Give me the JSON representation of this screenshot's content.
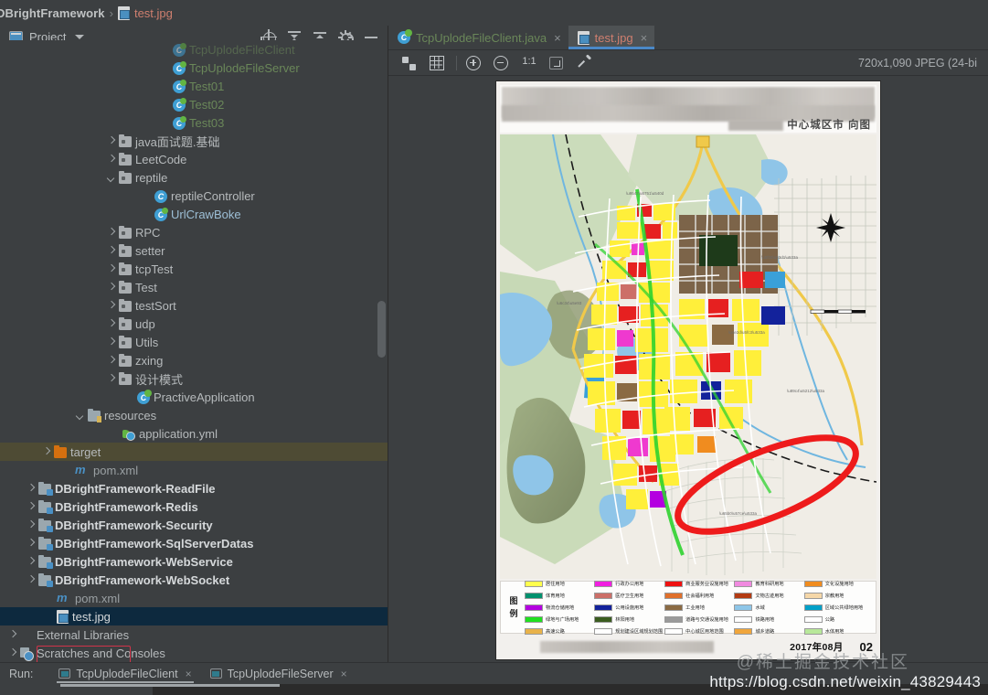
{
  "breadcrumb": {
    "root": "DBrightFramework",
    "separator": "›",
    "file": "test.jpg",
    "file_icon": "image-file-icon"
  },
  "project_panel": {
    "title": "Project",
    "dropdown_icon": "chevron-down-icon",
    "tools": [
      {
        "name": "locate-in-tree-icon",
        "label": "Select Opened File"
      },
      {
        "name": "expand-all-icon",
        "label": "Expand All"
      },
      {
        "name": "collapse-all-icon",
        "label": "Collapse All"
      },
      {
        "name": "settings-gear-icon",
        "label": "Settings"
      },
      {
        "name": "hide-panel-icon",
        "label": "Hide"
      }
    ]
  },
  "tree": {
    "rows": [
      {
        "label": "TcpUplodeFileClient",
        "indent": 175,
        "arrow": "none",
        "icon": "java-class-green-icon",
        "color": "#6a8759",
        "clipped": true
      },
      {
        "label": "TcpUplodeFileServer",
        "indent": 175,
        "arrow": "none",
        "icon": "java-class-green-icon",
        "color": "#6a8759"
      },
      {
        "label": "Test01",
        "indent": 175,
        "arrow": "none",
        "icon": "java-class-green-icon",
        "color": "#6a8759"
      },
      {
        "label": "Test02",
        "indent": 175,
        "arrow": "none",
        "icon": "java-class-green-icon",
        "color": "#6a8759"
      },
      {
        "label": "Test03",
        "indent": 175,
        "arrow": "none",
        "icon": "java-class-green-icon",
        "color": "#6a8759"
      },
      {
        "label": "java面试题.基础",
        "indent": 116,
        "arrow": "right",
        "icon": "package-folder-icon",
        "color": "#b6babc"
      },
      {
        "label": "LeetCode",
        "indent": 116,
        "arrow": "right",
        "icon": "package-folder-icon",
        "color": "#b6babc"
      },
      {
        "label": "reptile",
        "indent": 116,
        "arrow": "down",
        "icon": "package-folder-icon",
        "color": "#b6babc"
      },
      {
        "label": "reptileController",
        "indent": 155,
        "arrow": "none",
        "icon": "java-class-icon",
        "color": "#b6babc"
      },
      {
        "label": "UrlCrawBoke",
        "indent": 155,
        "arrow": "none",
        "icon": "java-class-green-icon",
        "color": "#9dbfd6"
      },
      {
        "label": "RPC",
        "indent": 116,
        "arrow": "right",
        "icon": "package-folder-icon",
        "color": "#b6babc"
      },
      {
        "label": "setter",
        "indent": 116,
        "arrow": "right",
        "icon": "package-folder-icon",
        "color": "#b6babc"
      },
      {
        "label": "tcpTest",
        "indent": 116,
        "arrow": "right",
        "icon": "package-folder-icon",
        "color": "#b6babc"
      },
      {
        "label": "Test",
        "indent": 116,
        "arrow": "right",
        "icon": "package-folder-icon",
        "color": "#b6babc"
      },
      {
        "label": "testSort",
        "indent": 116,
        "arrow": "right",
        "icon": "package-folder-icon",
        "color": "#b6babc"
      },
      {
        "label": "udp",
        "indent": 116,
        "arrow": "right",
        "icon": "package-folder-icon",
        "color": "#b6babc"
      },
      {
        "label": "Utils",
        "indent": 116,
        "arrow": "right",
        "icon": "package-folder-icon",
        "color": "#b6babc"
      },
      {
        "label": "zxing",
        "indent": 116,
        "arrow": "right",
        "icon": "package-folder-icon",
        "color": "#b6babc"
      },
      {
        "label": "设计模式",
        "indent": 116,
        "arrow": "right",
        "icon": "package-folder-icon",
        "color": "#b6babc"
      },
      {
        "label": "PractiveApplication",
        "indent": 136,
        "arrow": "none",
        "icon": "spring-boot-class-icon",
        "color": "#b6babc"
      },
      {
        "label": "resources",
        "indent": 82,
        "arrow": "down",
        "icon": "resources-folder-icon",
        "color": "#b6babc"
      },
      {
        "label": "application.yml",
        "indent": 120,
        "arrow": "none",
        "icon": "yaml-file-icon",
        "color": "#b6babc"
      },
      {
        "label": "target",
        "indent": 45,
        "arrow": "right",
        "icon": "excluded-folder-icon",
        "color": "#b6babc",
        "highlight": "target"
      },
      {
        "label": "pom.xml",
        "indent": 68,
        "arrow": "none",
        "icon": "maven-file-icon",
        "color": "#9aa0a3"
      },
      {
        "label": "DBrightFramework-ReadFile",
        "indent": 28,
        "arrow": "right",
        "icon": "module-folder-icon",
        "color": "#d6d9db",
        "bold": true
      },
      {
        "label": "DBrightFramework-Redis",
        "indent": 28,
        "arrow": "right",
        "icon": "module-folder-icon",
        "color": "#d6d9db",
        "bold": true
      },
      {
        "label": "DBrightFramework-Security",
        "indent": 28,
        "arrow": "right",
        "icon": "module-folder-icon",
        "color": "#d6d9db",
        "bold": true
      },
      {
        "label": "DBrightFramework-SqlServerDatas",
        "indent": 28,
        "arrow": "right",
        "icon": "module-folder-icon",
        "color": "#d6d9db",
        "bold": true
      },
      {
        "label": "DBrightFramework-WebService",
        "indent": 28,
        "arrow": "right",
        "icon": "module-folder-icon",
        "color": "#d6d9db",
        "bold": true
      },
      {
        "label": "DBrightFramework-WebSocket",
        "indent": 28,
        "arrow": "right",
        "icon": "module-folder-icon",
        "color": "#d6d9db",
        "bold": true
      },
      {
        "label": "pom.xml",
        "indent": 48,
        "arrow": "none",
        "icon": "maven-file-icon",
        "color": "#9aa0a3"
      },
      {
        "label": "test.jpg",
        "indent": 48,
        "arrow": "none",
        "icon": "image-file-icon",
        "color": "#d6d9db",
        "highlight": "selected"
      },
      {
        "label": "External Libraries",
        "indent": 8,
        "arrow": "right",
        "icon": "external-libraries-icon",
        "color": "#b6babc"
      },
      {
        "label": "Scratches and Consoles",
        "indent": 8,
        "arrow": "right",
        "icon": "scratches-icon",
        "color": "#b6babc"
      }
    ]
  },
  "editor_tabs": [
    {
      "label": "TcpUplodeFileClient.java",
      "icon": "java-class-green-icon",
      "active": false,
      "close": "×"
    },
    {
      "label": "test.jpg",
      "icon": "image-file-icon",
      "active": true,
      "close": "×"
    }
  ],
  "image_toolbar": {
    "buttons": [
      {
        "name": "transparency-checker-icon",
        "label": "Toggle transparency chessboard"
      },
      {
        "name": "grid-icon",
        "label": "Toggle grid"
      },
      {
        "name": "zoom-in-icon",
        "label": "Zoom In"
      },
      {
        "name": "zoom-out-icon",
        "label": "Zoom Out"
      },
      {
        "name": "actual-size-icon",
        "label": "1:1"
      },
      {
        "name": "fit-to-window-icon",
        "label": "Fit zoom to window"
      },
      {
        "name": "color-picker-icon",
        "label": "Pick color"
      }
    ],
    "actual_size_label": "1:1",
    "image_info": "720x1,090 JPEG (24-bi"
  },
  "map_document": {
    "header_title_suffix": "中心城区市 向图",
    "legend_char_1": "图",
    "legend_char_2": "例",
    "legend_items": [
      {
        "color": "#ffff4d",
        "text": "居住用地"
      },
      {
        "color": "#00916e",
        "text": "体育用地"
      },
      {
        "color": "#b400e0",
        "text": "物流仓储用地"
      },
      {
        "color": "#1fe01f",
        "text": "绿地与广场用地"
      },
      {
        "color": "#e8b24a",
        "text": "高速公路"
      },
      {
        "color": "#f020e0",
        "text": "行政办公用地"
      },
      {
        "color": "#cc6f68",
        "text": "医疗卫生用地"
      },
      {
        "color": "#13229b",
        "text": "公用设施用地"
      },
      {
        "color": "#3a5c1f",
        "text": "林阳用地"
      },
      {
        "color": "#ffffff",
        "text": "规划建设区域规划范围"
      },
      {
        "color": "#ee1111",
        "text": "商业服务业设施用地"
      },
      {
        "color": "#e0702b",
        "text": "社会福利用地"
      },
      {
        "color": "#8a6a43",
        "text": "工业用地"
      },
      {
        "color": "#9a9a9a",
        "text": "道路与交通设施用地"
      },
      {
        "color": "#ffffff",
        "text": "中心城区用地范围"
      },
      {
        "color": "#f08adf",
        "text": "教育科研用地"
      },
      {
        "color": "#b33b12",
        "text": "文物古迹用地"
      },
      {
        "color": "#8ec6e8",
        "text": "水域"
      },
      {
        "color": "#ffffff",
        "text": "铁路用地"
      },
      {
        "color": "#f0a63c",
        "text": "城乡道路"
      },
      {
        "color": "#f08c1f",
        "text": "文化设施用地"
      },
      {
        "color": "#f5d7a8",
        "text": "宗教用地"
      },
      {
        "color": "#00a0c8",
        "text": "区域公共绿地用地"
      },
      {
        "color": "#ffffff",
        "text": "公路"
      },
      {
        "color": "#b8e89a",
        "text": "水体用地"
      }
    ],
    "footer_date": "2017年08月",
    "page_number": "02"
  },
  "run_panel": {
    "label": "Run:",
    "tabs": [
      {
        "label": "TcpUplodeFileClient",
        "active": true,
        "close": "×",
        "icon": "run-config-icon"
      },
      {
        "label": "TcpUplodeFileServer",
        "active": false,
        "close": "×",
        "icon": "run-config-icon"
      }
    ]
  },
  "watermarks": {
    "community": "@稀土掘金技术社区",
    "url": "https://blog.csdn.net/weixin_43829443"
  },
  "colors": {
    "accent_blue": "#4a88c7",
    "selection_blue": "#0d293e",
    "highlight_yellow": "#4e4b34",
    "annotation_red": "#d1344a",
    "panel_bg": "#3c3f41",
    "string_green": "#6a8759",
    "file_orange": "#cf7f6f"
  }
}
